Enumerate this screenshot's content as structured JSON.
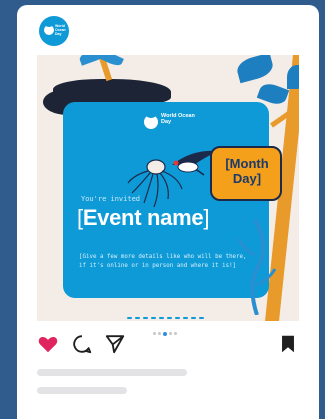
{
  "profile": {
    "avatar_text": "World Ocean Day"
  },
  "post": {
    "logo_text": "World Ocean Day",
    "invited_text": "You're invited",
    "event_bracket_open": "[",
    "event_name": "Event name",
    "event_bracket_close": "]",
    "details": "[Give a few more details like who will be there, if it's online or in person and where it is!]",
    "badge_text": "[Month Day]"
  },
  "carousel": {
    "count": 5,
    "active_index": 2
  },
  "actions": {
    "like_icon": "heart-icon",
    "comment_icon": "comment-icon",
    "share_icon": "send-icon",
    "save_icon": "bookmark-icon"
  },
  "colors": {
    "background": "#2f5b8d",
    "ocean_blue": "#0e9ad7",
    "badge_orange": "#f5a01a",
    "like_red": "#e0245e",
    "dark_navy": "#1d2436"
  }
}
